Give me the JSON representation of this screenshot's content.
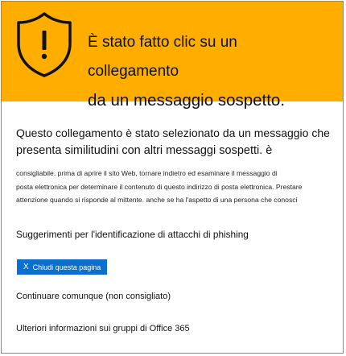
{
  "banner": {
    "icon": "shield-warning-icon",
    "color": "#ffae00",
    "title_line1": "È stato fatto clic su un collegamento",
    "title_line2": "da un messaggio sospetto."
  },
  "content": {
    "lead_line1": "Questo collegamento è stato selezionato da un messaggio che",
    "lead_line2": "presenta similitudini con altri messaggi sospetti. è",
    "body_line1": "consigliabile. prima di aprire il sito Web, tornare indietro ed esaminare il messaggio di",
    "body_line2": "posta elettronica per determinare il contenuto di questo indirizzo di posta elettronica. Prestare",
    "body_line3": "attenzione quando si risponde al mittente. anche se ha l'aspetto di una persona che conosci",
    "tips_link": "Suggerimenti per l'identificazione di attacchi di phishing",
    "close_button": {
      "icon": "close-icon",
      "glyph": "X",
      "label": "Chiudi questa pagina",
      "color": "#0a6fce"
    },
    "continue_link": "Continuare comunque (non consigliato)",
    "more_info_link": "Ulteriori informazioni sui gruppi di Office 365"
  }
}
